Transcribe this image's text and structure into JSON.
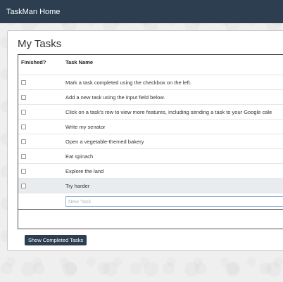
{
  "navbar": {
    "brand": "TaskMan Home"
  },
  "main": {
    "title": "My Tasks",
    "table": {
      "headers": {
        "finished": "Finished?",
        "task_name": "Task Name"
      },
      "tasks": [
        {
          "name": "Mark a task completed using the checkbox on the left.",
          "finished": false
        },
        {
          "name": "Add a new task using the input field below.",
          "finished": false
        },
        {
          "name": "Click on a task's row to view more features, including sending a task to your Google cale",
          "finished": false
        },
        {
          "name": "Write my senator",
          "finished": false
        },
        {
          "name": "Open a vegetable-themed bakery",
          "finished": false
        },
        {
          "name": "Eat spinach",
          "finished": false
        },
        {
          "name": "Explore the land",
          "finished": false
        },
        {
          "name": "Try harder",
          "finished": false
        }
      ],
      "new_task_placeholder": "New Task",
      "new_task_value": ""
    },
    "show_completed_label": "Show Completed Tasks"
  }
}
